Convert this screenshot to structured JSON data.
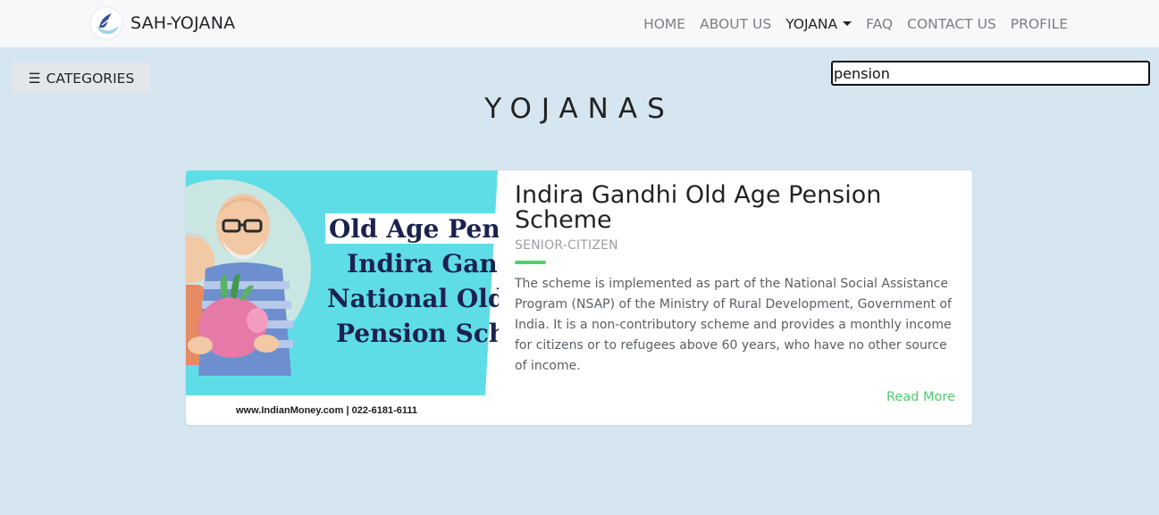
{
  "navbar": {
    "brand": "SAH-YOJANA",
    "links": [
      {
        "label": "HOME"
      },
      {
        "label": "ABOUT US"
      },
      {
        "label": "YOJANA"
      },
      {
        "label": "FAQ"
      },
      {
        "label": "CONTACT US"
      },
      {
        "label": "PROFILE"
      }
    ]
  },
  "categories_button": {
    "icon": "☰",
    "label": "CATEGORIES"
  },
  "search": {
    "value": "pension"
  },
  "page_title": "YOJANAS",
  "card": {
    "title": "Indira Gandhi Old Age Pension Scheme",
    "category": "SENIOR-CITIZEN",
    "description": "The scheme is implemented as part of the National Social Assistance Program (NSAP) of the Ministry of Rural Development, Government of India. It is a non-contributory scheme and provides a monthly income for citizens or to refugees above 60 years, who have no other source of income.",
    "read_more": "Read More",
    "image_text": {
      "line1": "Old Age Pens",
      "line2": "Indira Ganc",
      "line3": "National Old",
      "line4": "Pension Sch",
      "footer": "www.IndianMoney.com | 022-6181-6111"
    }
  },
  "colors": {
    "page_bg": "#d6e6f1",
    "navbar_bg": "#f7f8fa",
    "accent_green": "#4fd16c",
    "image_cyan": "#5fdde6"
  },
  "icons": {
    "brand_logo": "hand-leaf-logo",
    "categories": "hamburger-icon",
    "dropdown": "caret-down-icon"
  }
}
